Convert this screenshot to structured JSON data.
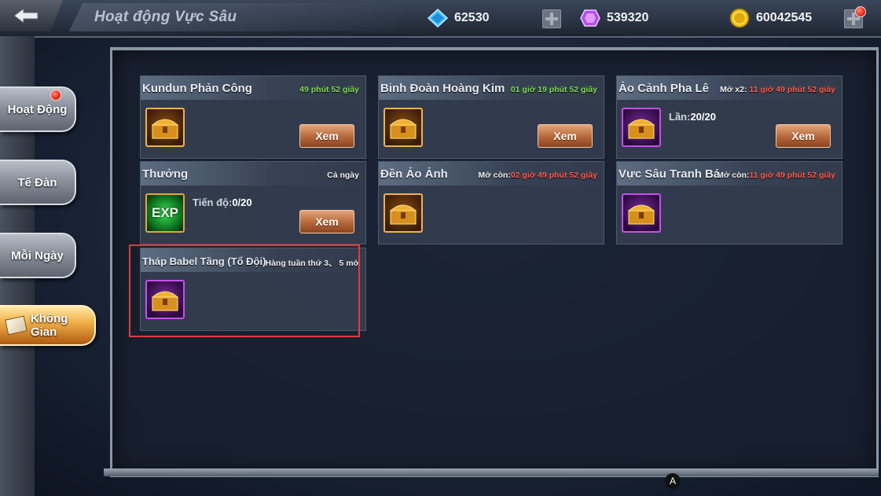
{
  "header": {
    "title": "Hoạt động Vực Sâu",
    "diamonds": "62530",
    "crystals": "539320",
    "gold": "60042545"
  },
  "sidebar": {
    "items": [
      {
        "label": "Hoạt Động"
      },
      {
        "label": "Tế Đàn"
      },
      {
        "label": "Mỗi Ngày"
      },
      {
        "label": "Không Gian"
      }
    ]
  },
  "cards": [
    {
      "title": "Kundun Phản Công",
      "time": "49 phút 52 giây",
      "button": "Xem"
    },
    {
      "title": "Binh Đoàn Hoàng Kim",
      "time": "01 giờ 19 phút 52 giây",
      "button": "Xem"
    },
    {
      "title": "Ảo Cảnh Pha Lê",
      "time_prefix": "Mở x2:",
      "time": "11 giờ 49 phút 52 giây",
      "progress_label": "Lần:",
      "progress_value": "20/20",
      "button": "Xem"
    },
    {
      "title": "Thưởng",
      "time": "Cả ngày",
      "progress_label": "Tiến độ:",
      "progress_value": "0/20",
      "icon_text": "EXP",
      "button": "Xem"
    },
    {
      "title": "Đền Ảo Ảnh",
      "time_prefix": "Mở còn:",
      "time": "02 giờ 49 phút 52 giây"
    },
    {
      "title": "Vực Sâu Tranh Bá",
      "time_prefix": "Mở còn:",
      "time": "11 giờ 49 phút 52 giây"
    },
    {
      "title": "Tháp Babel Tầng (Tổ Đội)",
      "time": "Hàng tuần thứ 3、 5 mở"
    }
  ],
  "overlay_badge": "A",
  "colors": {
    "timer_green": "#7fdc52",
    "timer_red": "#ff5a4a",
    "button_bronze": "#b5673a",
    "active_tab_gold": "#f2b24a",
    "selection_red": "#e23b3b"
  }
}
